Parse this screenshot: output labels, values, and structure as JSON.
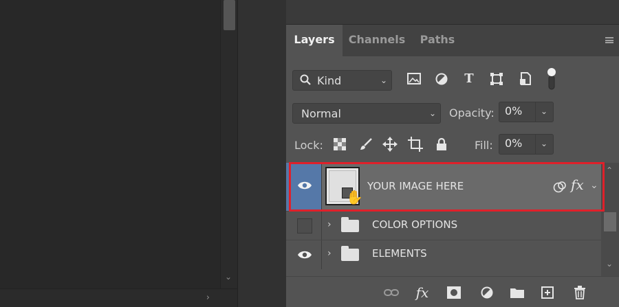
{
  "tabs": [
    {
      "label": "Layers"
    },
    {
      "label": "Channels"
    },
    {
      "label": "Paths"
    }
  ],
  "filter": {
    "kind_label": "Kind"
  },
  "blend": {
    "mode": "Normal",
    "opacity_label": "Opacity:",
    "opacity_value": "0%"
  },
  "lock": {
    "label": "Lock:",
    "fill_label": "Fill:",
    "fill_value": "0%"
  },
  "layers": [
    {
      "name": "YOUR IMAGE HERE",
      "fx": "fx"
    },
    {
      "name": "COLOR OPTIONS"
    },
    {
      "name": "ELEMENTS"
    }
  ],
  "colors": {
    "highlight": "#e0202a",
    "selected_eye_bg": "#5578a8"
  },
  "bottom": {
    "fx_label": "fx"
  }
}
